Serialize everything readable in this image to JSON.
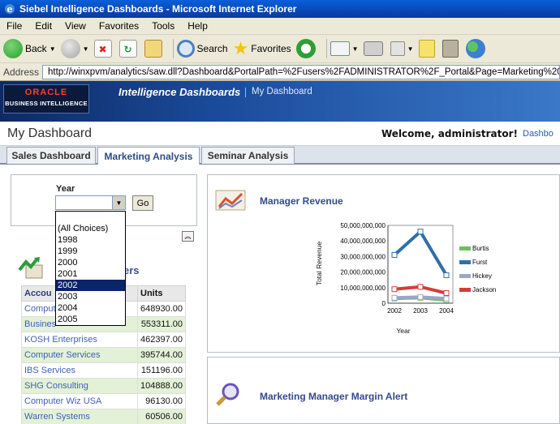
{
  "window": {
    "title": "Siebel Intelligence Dashboards - Microsoft Internet Explorer"
  },
  "menu": [
    "File",
    "Edit",
    "View",
    "Favorites",
    "Tools",
    "Help"
  ],
  "toolbar": {
    "back": "Back",
    "search": "Search",
    "favorites": "Favorites"
  },
  "address": {
    "label": "Address",
    "url": "http://winxpvm/analytics/saw.dll?Dashboard&PortalPath=%2Fusers%2FADMINISTRATOR%2F_Portal&Page=Marketing%20An"
  },
  "banner": {
    "logo_top": "ORACLE",
    "logo_bottom": "BUSINESS INTELLIGENCE",
    "title": "Intelligence Dashboards",
    "dashboard_link": "My Dashboard"
  },
  "header": {
    "title": "My Dashboard",
    "welcome": "Welcome, administrator!",
    "link": "Dashbo"
  },
  "tabs": [
    {
      "label": "Sales Dashboard",
      "active": false
    },
    {
      "label": "Marketing Analysis",
      "active": true
    },
    {
      "label": "Seminar Analysis",
      "active": false
    }
  ],
  "prompt": {
    "label": "Year",
    "go": "Go",
    "options": [
      "(All Choices)",
      "1998",
      "1999",
      "2000",
      "2001",
      "2002",
      "2003",
      "2004",
      "2005"
    ],
    "highlighted": "2002"
  },
  "top_customers": {
    "title": "ers",
    "columns": [
      "Accou",
      "Units"
    ],
    "rows": [
      {
        "name": "Compute",
        "units": "648930.00"
      },
      {
        "name": "Busines",
        "units": "553311.00"
      },
      {
        "name": "KOSH Enterprises",
        "units": "462397.00"
      },
      {
        "name": "Computer Services",
        "units": "395744.00"
      },
      {
        "name": "IBS Services",
        "units": "151196.00"
      },
      {
        "name": "SHG Consulting",
        "units": "104888.00"
      },
      {
        "name": "Computer Wiz USA",
        "units": "96130.00"
      },
      {
        "name": "Warren Systems",
        "units": "60506.00"
      }
    ]
  },
  "manager_revenue": {
    "title": "Manager Revenue"
  },
  "margin_alert": {
    "title": "Marketing Manager Margin Alert"
  },
  "chart_data": {
    "type": "line",
    "x": [
      "2002",
      "2003",
      "2004"
    ],
    "series": [
      {
        "name": "Burtis",
        "values": [
          3000000000,
          3500000000,
          2000000000
        ],
        "color": "#6fbe62"
      },
      {
        "name": "Furst",
        "values": [
          31000000000,
          46000000000,
          18000000000
        ],
        "color": "#2f6fa8"
      },
      {
        "name": "Hickey",
        "values": [
          3500000000,
          4000000000,
          3000000000
        ],
        "color": "#9aa7c7"
      },
      {
        "name": "Jackson",
        "values": [
          9000000000,
          10500000000,
          6500000000
        ],
        "color": "#d63b3b"
      }
    ],
    "yticks": [
      "0",
      "10,000,000,000",
      "20,000,000,000",
      "30,000,000,000",
      "40,000,000,000",
      "50,000,000,000"
    ],
    "ylim": [
      0,
      50000000000
    ],
    "xlabel": "Year",
    "ylabel": "Total Revenue",
    "grid": false,
    "legend": "right"
  }
}
